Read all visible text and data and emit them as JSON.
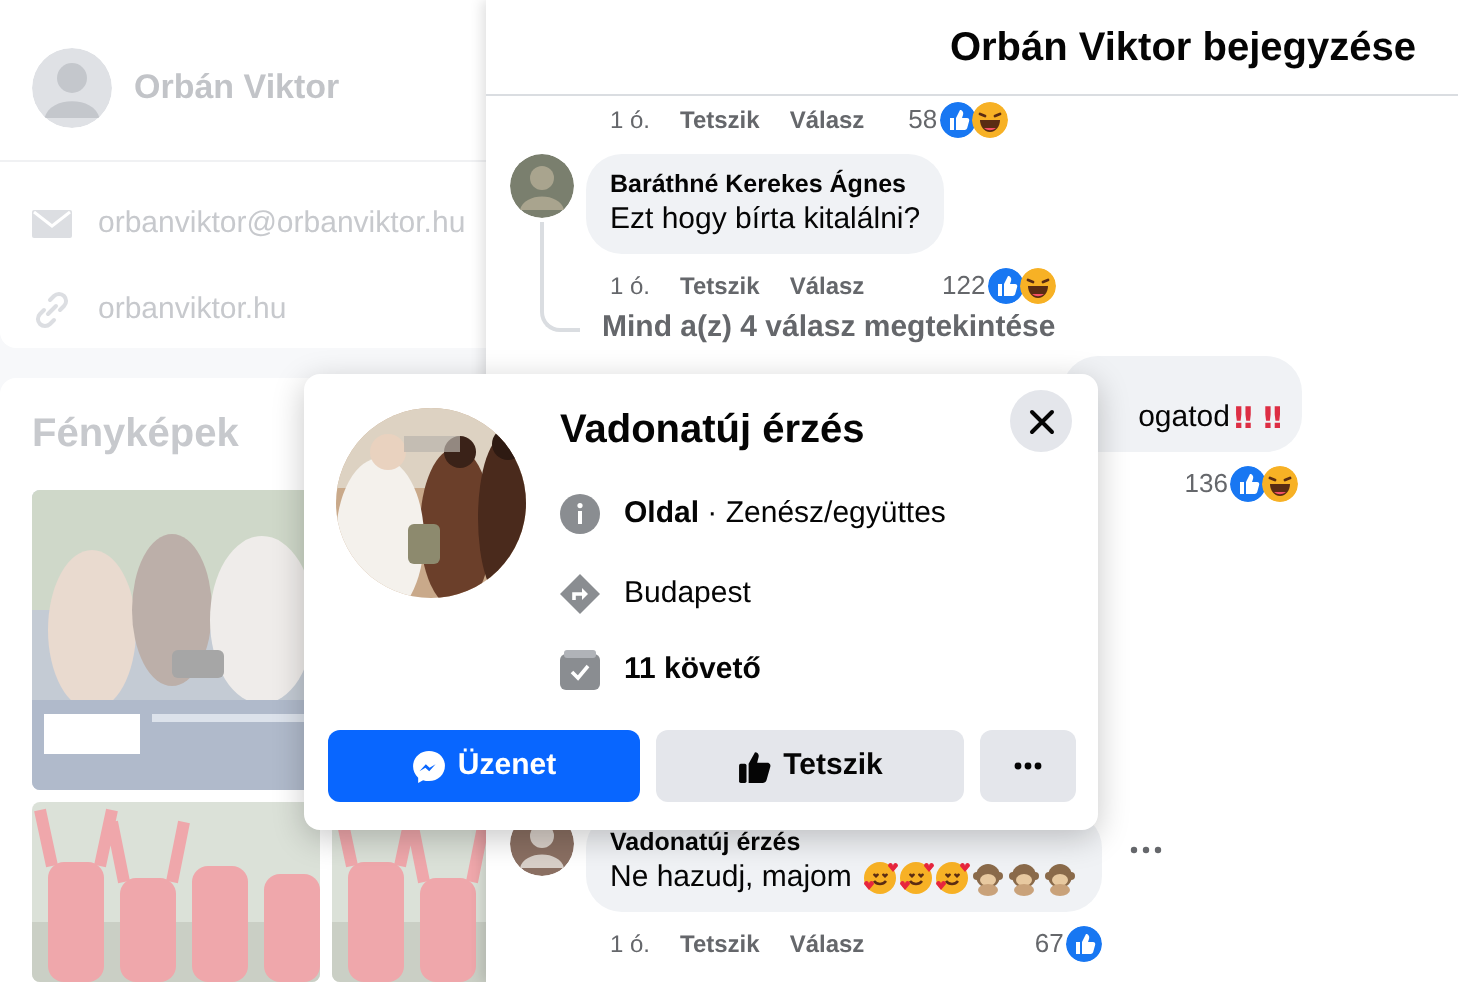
{
  "profile_sidebar": {
    "name": "Orbán Viktor",
    "email": "orbanviktor@orbanviktor.hu",
    "website": "orbanviktor.hu",
    "photos_title": "Fényképek"
  },
  "post_panel": {
    "title": "Orbán Viktor bejegyzése"
  },
  "comments": [
    {
      "kind": "tail",
      "time": "1 ó.",
      "like": "Tetszik",
      "reply": "Válasz",
      "reaction_count": "58",
      "reactions": [
        {
          "kind": "like"
        },
        {
          "kind": "haha"
        }
      ]
    },
    {
      "kind": "full",
      "author": "Baráthné Kerekes Ágnes",
      "text": "Ezt hogy bírta kitalálni?",
      "time": "1 ó.",
      "like": "Tetszik",
      "reply": "Válasz",
      "reaction_count": "122",
      "reactions": [
        {
          "kind": "like"
        },
        {
          "kind": "haha"
        }
      ],
      "replies_link": "Mind a(z) 4 válasz megtekintése"
    },
    {
      "kind": "partial",
      "text": "ogatod",
      "emphasis": "‼ ‼",
      "reaction_count": "136",
      "reactions": [
        {
          "kind": "like"
        },
        {
          "kind": "haha"
        }
      ]
    },
    {
      "kind": "full",
      "author": "Vadonatúj érzés",
      "text": "Ne hazudj, majom",
      "emoji": [
        {
          "kind": "hearts"
        },
        {
          "kind": "hearts"
        },
        {
          "kind": "hearts"
        },
        {
          "kind": "monkey"
        },
        {
          "kind": "monkey"
        },
        {
          "kind": "monkey"
        }
      ],
      "time": "1 ó.",
      "like": "Tetszik",
      "reply": "Válasz",
      "reaction_count": "67",
      "reactions": [
        {
          "kind": "like"
        }
      ],
      "more": true
    }
  ],
  "page_popup": {
    "title": "Vadonatúj érzés",
    "category_line": "**Oldal** · Zenész/együttes",
    "location": "Budapest",
    "followers": "11 követő",
    "buttons": [
      {
        "kind": "message",
        "label": "Üzenet"
      },
      {
        "kind": "like",
        "label": "Tetszik"
      },
      {
        "kind": "more"
      }
    ]
  }
}
